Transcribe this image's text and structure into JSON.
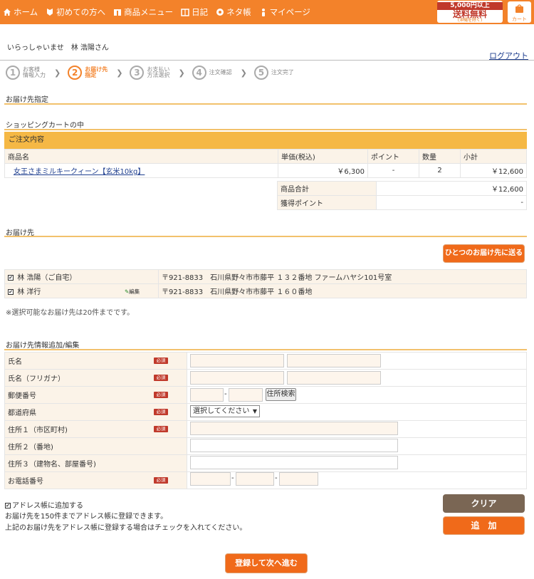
{
  "nav": {
    "items": [
      {
        "label": "ホーム",
        "icon": "home-icon"
      },
      {
        "label": "初めての方へ",
        "icon": "leaf-icon"
      },
      {
        "label": "商品メニュー",
        "icon": "gift-icon"
      },
      {
        "label": "日記",
        "icon": "book-icon"
      },
      {
        "label": "ネタ帳",
        "icon": "note-icon"
      },
      {
        "label": "マイページ",
        "icon": "person-icon"
      }
    ],
    "promo_line1": "5,000円以上",
    "promo_line2": "送料無料",
    "promo_line3": "(沖縄を除く)",
    "cart_label": "カート"
  },
  "welcome": "いらっしゃいませ　林 浩陽さん",
  "logout": "ログアウト",
  "steps": [
    {
      "num": "1",
      "line1": "お客様",
      "line2": "情報入力",
      "active": false
    },
    {
      "num": "2",
      "line1": "お届け先",
      "line2": "指定",
      "active": true
    },
    {
      "num": "3",
      "line1": "お支払い",
      "line2": "方法選択",
      "active": false
    },
    {
      "num": "4",
      "line1": "注文確認",
      "line2": "",
      "active": false
    },
    {
      "num": "5",
      "line1": "注文完了",
      "line2": "",
      "active": false
    }
  ],
  "sections": {
    "delivery_spec": "お届け先指定",
    "cart": "ショッピングカートの中",
    "destination": "お届け先",
    "address_edit": "お届け先情報追加/編集"
  },
  "order": {
    "bar_title": "ご注文内容",
    "headers": [
      "商品名",
      "単価(税込)",
      "ポイント",
      "数量",
      "小計"
    ],
    "rows": [
      {
        "name": "女王さまミルキークィーン【玄米10kg】",
        "price": "￥6,300",
        "point": "-",
        "qty": "2",
        "subtotal": "￥12,600"
      }
    ],
    "summary": [
      {
        "label": "商品合計",
        "value": "￥12,600"
      },
      {
        "label": "獲得ポイント",
        "value": "-"
      }
    ]
  },
  "destinations": {
    "send_one_button": "ひとつのお届け先に送る",
    "rows": [
      {
        "check": "✔",
        "name": "林 浩陽（ご自宅）",
        "edit": "",
        "address": "〒921-8833　石川県野々市市藤平 １３２番地 ファームハヤシ101号室"
      },
      {
        "check": "✔",
        "name": "林 洋行",
        "edit": "編集",
        "address": "〒921-8833　石川県野々市市藤平 １６０番地"
      }
    ],
    "note": "※選択可能なお届け先は20件までです。"
  },
  "form": {
    "required_label": "必須",
    "fields": [
      {
        "label": "氏名",
        "required": true
      },
      {
        "label": "氏名（フリガナ）",
        "required": true
      },
      {
        "label": "郵便番号",
        "required": true
      },
      {
        "label": "都道府県",
        "required": true
      },
      {
        "label": "住所１（市区町村)",
        "required": true
      },
      {
        "label": "住所２（番地)",
        "required": false
      },
      {
        "label": "住所３（建物名、部屋番号)",
        "required": false
      },
      {
        "label": "お電話番号",
        "required": true
      }
    ],
    "zip_search": "住所検索",
    "pref_select": "選択してください",
    "dash": "-"
  },
  "bottom": {
    "add_checkbox_label": "アドレス帳に追加する",
    "note1": "お届け先を150件までアドレス帳に登録できます。",
    "note2": "上記のお届け先をアドレス帳に登録する場合はチェックを入れてください。",
    "clear_button": "クリア",
    "add_button": "追　加",
    "submit_button": "登録して次へ進む"
  },
  "colors": {
    "accent": "#f3822a",
    "header_bar": "#f5b845",
    "required": "#c0392b"
  }
}
